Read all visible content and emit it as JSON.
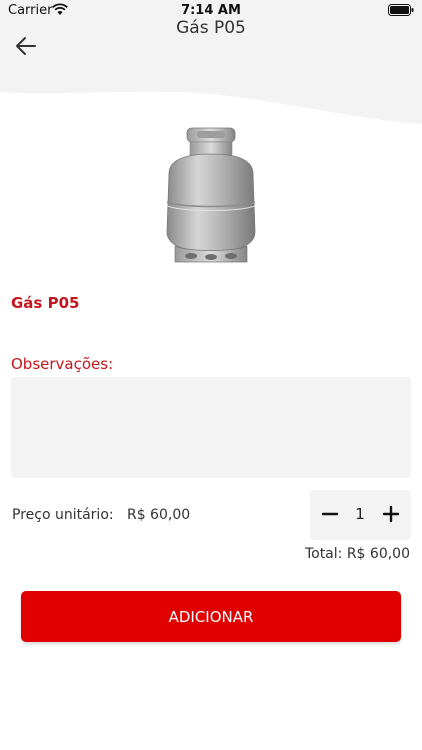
{
  "status_bar": {
    "carrier": "Carrier",
    "time": "7:14 AM",
    "wifi_icon": "wifi-icon",
    "battery_icon": "battery-icon"
  },
  "header": {
    "title": "Gás P05",
    "back_icon": "arrow-left-icon",
    "background_color": "#f3f3f3"
  },
  "product": {
    "name": "Gás P05",
    "image": "gas-cylinder-image"
  },
  "observations": {
    "label": "Observações:",
    "value": "",
    "placeholder": ""
  },
  "pricing": {
    "unit_price_label": "Preço unitário:",
    "unit_price_value": "R$ 60,00",
    "quantity": "1",
    "total_label": "Total:",
    "total_value": "R$ 60,00"
  },
  "actions": {
    "add_label": "ADICIONAR"
  },
  "colors": {
    "accent": "#c4161c",
    "button": "#e00000",
    "surface": "#f3f3f3"
  }
}
